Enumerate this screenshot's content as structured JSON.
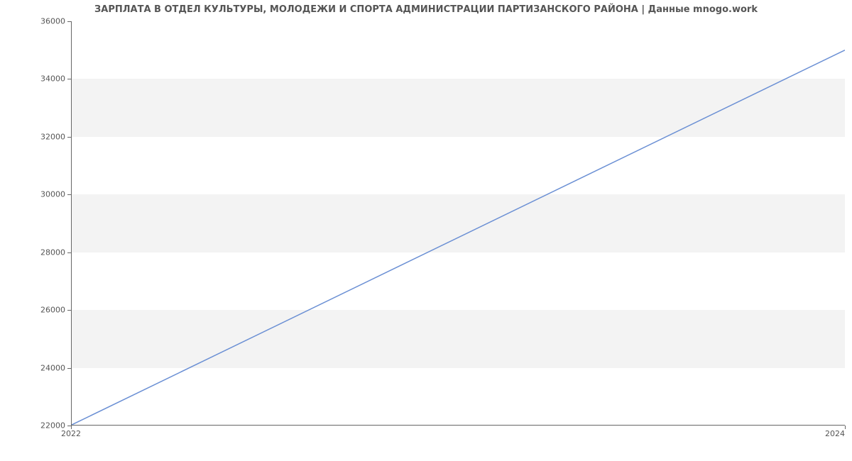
{
  "chart_data": {
    "type": "line",
    "title": "ЗАРПЛАТА В ОТДЕЛ КУЛЬТУРЫ, МОЛОДЕЖИ И СПОРТА АДМИНИСТРАЦИИ ПАРТИЗАНСКОГО РАЙОНА | Данные mnogo.work",
    "x": [
      2022,
      2024
    ],
    "values": [
      22000,
      35000
    ],
    "x_tick_labels": [
      "2022",
      "2024"
    ],
    "y_tick_labels": [
      "22000",
      "24000",
      "26000",
      "28000",
      "30000",
      "32000",
      "34000",
      "36000"
    ],
    "y_ticks": [
      22000,
      24000,
      26000,
      28000,
      30000,
      32000,
      34000,
      36000
    ],
    "xlim": [
      2022,
      2024
    ],
    "ylim": [
      22000,
      36000
    ],
    "line_color": "#6a8fd4",
    "band_color": "#f3f3f3"
  }
}
